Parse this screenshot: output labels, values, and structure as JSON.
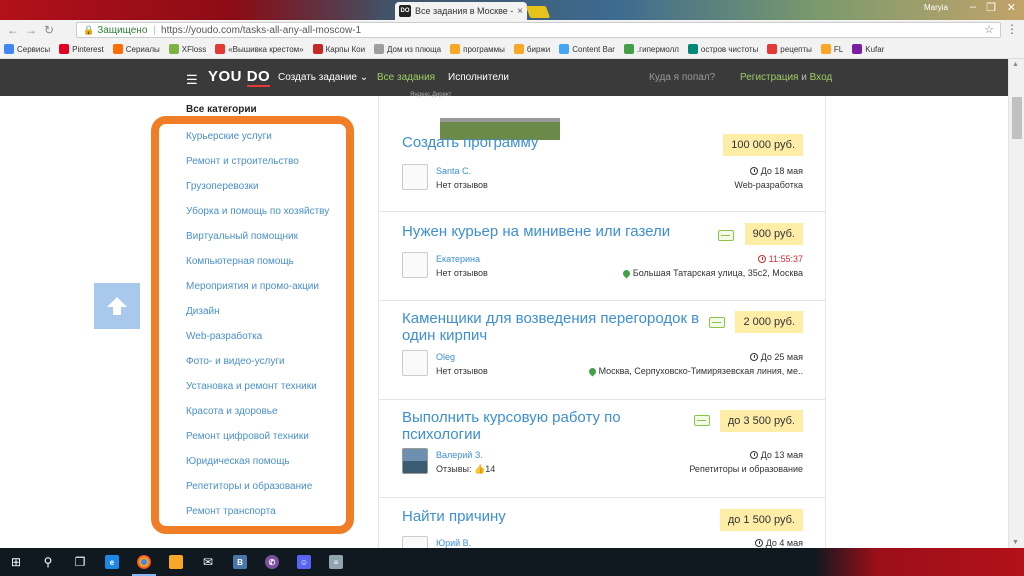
{
  "browser": {
    "tab_title": "Все задания в Москве -",
    "user": "Maryia",
    "secure_label": "Защищено",
    "url": "https://youdo.com/tasks-all-any-all-moscow-1",
    "bookmarks": [
      {
        "label": "Сервисы",
        "icon": "apps-icon",
        "color": "#4285f4"
      },
      {
        "label": "Pinterest",
        "icon": "pinterest-icon",
        "color": "#e60023"
      },
      {
        "label": "Сериалы",
        "icon": "flame-icon",
        "color": "#ff6d00"
      },
      {
        "label": "XFloss",
        "icon": "xfloss-icon",
        "color": "#7cb342"
      },
      {
        "label": "«Вышивка крестом»",
        "icon": "stitch-icon",
        "color": "#e53935"
      },
      {
        "label": "Карпы Кои",
        "icon": "m-icon",
        "color": "#c62828"
      },
      {
        "label": "Дом из плюща",
        "icon": "page-icon",
        "color": "#9e9e9e"
      },
      {
        "label": "программы",
        "icon": "folder-icon",
        "color": "#f9a825"
      },
      {
        "label": "биржи",
        "icon": "folder-icon",
        "color": "#f9a825"
      },
      {
        "label": "Content Bar",
        "icon": "cb-icon",
        "color": "#42a5f5"
      },
      {
        "label": ".гипермолл",
        "icon": "gm-icon",
        "color": "#43a047"
      },
      {
        "label": "остров чистоты",
        "icon": "island-icon",
        "color": "#00897b"
      },
      {
        "label": "рецепты",
        "icon": "recipe-icon",
        "color": "#e53935"
      },
      {
        "label": "FL",
        "icon": "folder-icon",
        "color": "#f9a825"
      },
      {
        "label": "Kufar",
        "icon": "kufar-icon",
        "color": "#7b1fa2"
      }
    ]
  },
  "site": {
    "logo_you": "YOU",
    "logo_do": "DO",
    "nav_create": "Создать задание",
    "nav_all_tasks": "Все задания",
    "nav_executors": "Исполнители",
    "nav_where": "Куда я попал?",
    "nav_register": "Регистрация",
    "nav_and": "и",
    "nav_login": "Вход",
    "ad_label": "Яндекс.Директ",
    "accent": "#9ccc65"
  },
  "sidebar": {
    "heading": "Все категории",
    "categories": [
      "Курьерские услуги",
      "Ремонт и строительство",
      "Грузоперевозки",
      "Уборка и помощь по хозяйству",
      "Виртуальный помощник",
      "Компьютерная помощь",
      "Мероприятия и промо-акции",
      "Дизайн",
      "Web-разработка",
      "Фото- и видео-услуги",
      "Установка и ремонт техники",
      "Красота и здоровье",
      "Ремонт цифровой техники",
      "Юридическая помощь",
      "Репетиторы и образование",
      "Ремонт транспорта"
    ]
  },
  "tasks": [
    {
      "title": "Создать программу",
      "price": "100 000 руб.",
      "user": "Santa C.",
      "reviews": "Нет отзывов",
      "deadline": "До 18 мая",
      "meta": "Web-разработка"
    },
    {
      "title": "Нужен курьер на минивене или газели",
      "price": "900 руб.",
      "user": "Екатерина",
      "reviews": "Нет отзывов",
      "deadline": "11:55:37",
      "meta": "Большая Татарская улица, 35с2, Москва"
    },
    {
      "title": "Каменщики для возведения перегородок в один кирпич",
      "title_l1": "Каменщики для возведения перегородок в",
      "title_l2": "один кирпич",
      "price": "2 000 руб.",
      "user": "Oleg",
      "reviews": "Нет отзывов",
      "deadline": "До 25 мая",
      "meta": "Москва, Серпуховско-Тимирязевская линия, ме.."
    },
    {
      "title_l1": "Выполнить курсовую работу по",
      "title_l2": "психологии",
      "price": "до 3 500 руб.",
      "user": "Валерий З.",
      "reviews": "Отзывы:",
      "reviews_count": "14",
      "deadline": "До 13 мая",
      "meta": "Репетиторы и образование"
    },
    {
      "title": "Найти причину",
      "price": "до 1 500 руб.",
      "user": "Юрий В.",
      "deadline": "До 4 мая"
    }
  ],
  "highlight_color": "#f07e26"
}
